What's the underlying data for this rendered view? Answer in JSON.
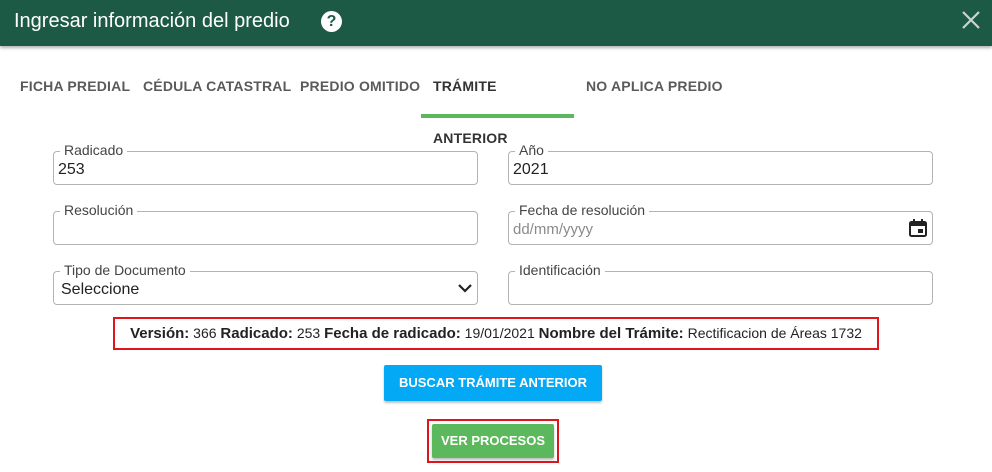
{
  "dialog": {
    "title": "Ingresar información del predio",
    "help": "?"
  },
  "tabs": [
    {
      "label": "FICHA PREDIAL"
    },
    {
      "label": "CÉDULA CATASTRAL"
    },
    {
      "label": "PREDIO OMITIDO"
    },
    {
      "label": "TRÁMITE ANTERIOR",
      "active": true
    },
    {
      "label": "NO APLICA PREDIO"
    }
  ],
  "form": {
    "radicado": {
      "label": "Radicado",
      "value": "253"
    },
    "anio": {
      "label": "Año",
      "value": "2021"
    },
    "resolucion": {
      "label": "Resolución",
      "value": ""
    },
    "fecha_resolucion": {
      "label": "Fecha de resolución",
      "placeholder": "dd/mm/yyyy"
    },
    "tipo_documento": {
      "label": "Tipo de Documento",
      "value": "Seleccione"
    },
    "identificacion": {
      "label": "Identificación",
      "value": ""
    }
  },
  "info": {
    "version_label": "Versión:",
    "version_value": "366",
    "radicado_label": "Radicado:",
    "radicado_value": "253",
    "fecha_label": "Fecha de radicado:",
    "fecha_value": "19/01/2021",
    "tramite_label": "Nombre del Trámite:",
    "tramite_value": "Rectificacion de Áreas 1732"
  },
  "buttons": {
    "search": "BUSCAR TRÁMITE ANTERIOR",
    "processes": "VER PROCESOS"
  },
  "colors": {
    "header": "#1c5a45",
    "tab_active": "#5cb85c",
    "primary": "#03a9f4",
    "success": "#5cb85c",
    "highlight": "#e0151b"
  }
}
